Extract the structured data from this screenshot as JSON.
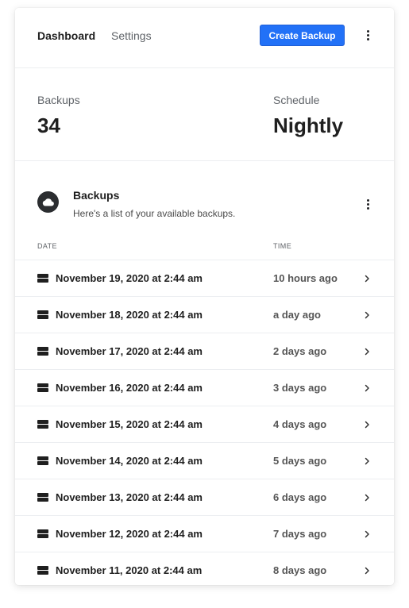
{
  "nav": {
    "tabs": [
      {
        "label": "Dashboard",
        "active": true
      },
      {
        "label": "Settings",
        "active": false
      }
    ],
    "create_button": "Create Backup"
  },
  "stats": {
    "backups_label": "Backups",
    "backups_value": "34",
    "schedule_label": "Schedule",
    "schedule_value": "Nightly"
  },
  "section": {
    "title": "Backups",
    "subtitle": "Here's a list of your available backups.",
    "icon": "cloud-icon"
  },
  "table": {
    "columns": [
      "DATE",
      "TIME"
    ],
    "rows": [
      {
        "date": "November 19, 2020 at 2:44 am",
        "time": "10 hours ago"
      },
      {
        "date": "November 18, 2020 at 2:44 am",
        "time": "a day ago"
      },
      {
        "date": "November 17, 2020 at 2:44 am",
        "time": "2 days ago"
      },
      {
        "date": "November 16, 2020 at 2:44 am",
        "time": "3 days ago"
      },
      {
        "date": "November 15, 2020 at 2:44 am",
        "time": "4 days ago"
      },
      {
        "date": "November 14, 2020 at 2:44 am",
        "time": "5 days ago"
      },
      {
        "date": "November 13, 2020 at 2:44 am",
        "time": "6 days ago"
      },
      {
        "date": "November 12, 2020 at 2:44 am",
        "time": "7 days ago"
      },
      {
        "date": "November 11, 2020 at 2:44 am",
        "time": "8 days ago"
      }
    ]
  },
  "colors": {
    "accent": "#2271f7",
    "text": "#1f1f1f",
    "muted": "#5f6368",
    "divider": "#eceef1"
  }
}
